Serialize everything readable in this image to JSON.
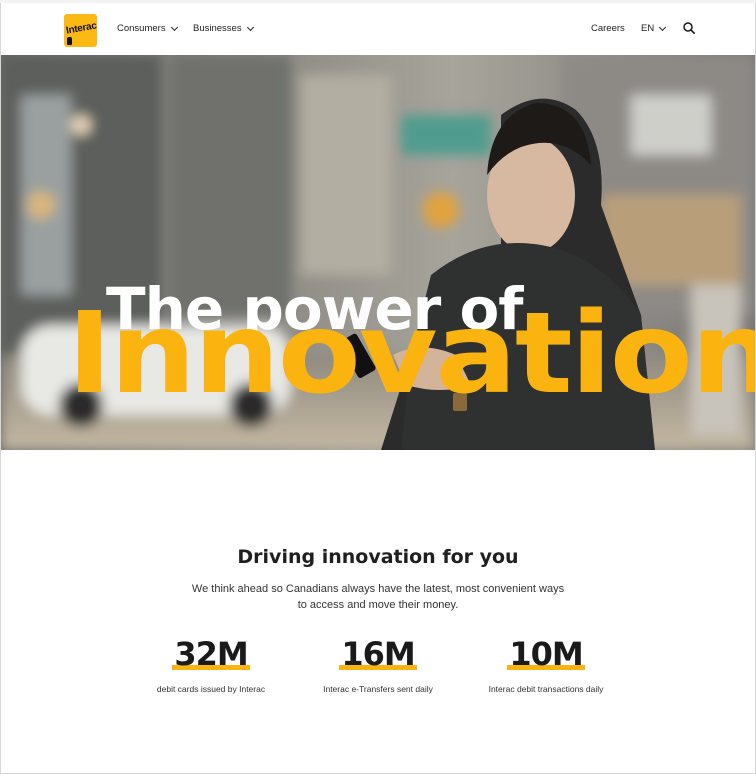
{
  "header": {
    "logo_text": "Interac",
    "nav": [
      "Consumers",
      "Businesses"
    ],
    "careers": "Careers",
    "language": "EN"
  },
  "hero": {
    "line1": "The power of",
    "line2": "Innovation"
  },
  "section": {
    "title": "Driving innovation for you",
    "description": "We think ahead so Canadians always have the latest, most convenient ways to access and move their money."
  },
  "stats": [
    {
      "value": "32M",
      "label": "debit cards issued by Interac"
    },
    {
      "value": "16M",
      "label": "Interac e-Transfers sent daily"
    },
    {
      "value": "10M",
      "label": "Interac debit transactions daily"
    }
  ],
  "colors": {
    "accent": "#fbb40f",
    "text": "#1b1b1b"
  }
}
